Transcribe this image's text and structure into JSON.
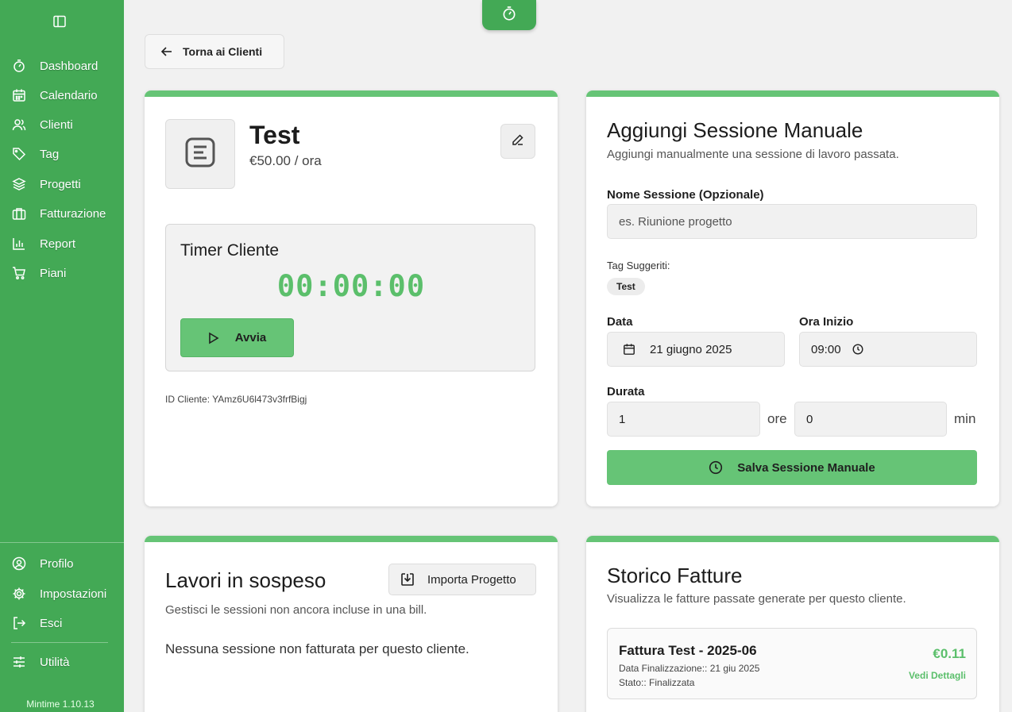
{
  "sidebar": {
    "nav": [
      {
        "label": "Dashboard",
        "icon": "stopwatch-icon"
      },
      {
        "label": "Calendario",
        "icon": "calendar-icon"
      },
      {
        "label": "Clienti",
        "icon": "users-icon"
      },
      {
        "label": "Tag",
        "icon": "tag-icon"
      },
      {
        "label": "Progetti",
        "icon": "layers-icon"
      },
      {
        "label": "Fatturazione",
        "icon": "briefcase-icon"
      },
      {
        "label": "Report",
        "icon": "bar-chart-icon"
      },
      {
        "label": "Piani",
        "icon": "cart-icon"
      }
    ],
    "bottom": [
      {
        "label": "Profilo",
        "icon": "user-circle-icon"
      },
      {
        "label": "Impostazioni",
        "icon": "gear-icon"
      },
      {
        "label": "Esci",
        "icon": "logout-icon"
      }
    ],
    "utility": {
      "label": "Utilità",
      "icon": "sliders-icon"
    },
    "version": "Mintime 1.10.13"
  },
  "back_button": {
    "label": "Torna ai Clienti"
  },
  "client": {
    "name": "Test",
    "rate": "€50.00 / ora",
    "timer_title": "Timer Cliente",
    "timer_value": "00:00:00",
    "start_label": "Avvia",
    "client_id": "ID Cliente: YAmz6U6l473v3frfBigj"
  },
  "manual_session": {
    "title": "Aggiungi Sessione Manuale",
    "subtitle": "Aggiungi manualmente una sessione di lavoro passata.",
    "name_label": "Nome Sessione (Opzionale)",
    "name_placeholder": "es. Riunione progetto",
    "suggested_tags_label": "Tag Suggeriti:",
    "suggested_tags": [
      "Test"
    ],
    "date_label": "Data",
    "date_value": "21 giugno 2025",
    "start_label": "Ora Inizio",
    "start_value": "09:00",
    "duration_label": "Durata",
    "hours_value": "1",
    "hours_unit": "ore",
    "minutes_value": "0",
    "minutes_unit": "min",
    "save_label": "Salva Sessione Manuale"
  },
  "pending": {
    "title": "Lavori in sospeso",
    "subtitle": "Gestisci le sessioni non ancora incluse in una bill.",
    "import_label": "Importa Progetto",
    "empty_message": "Nessuna sessione non fatturata per questo cliente."
  },
  "invoices": {
    "title": "Storico Fatture",
    "subtitle": "Visualizza le fatture passate generate per questo cliente.",
    "items": [
      {
        "title": "Fattura Test - 2025-06",
        "finalized": "Data Finalizzazione:: 21 giu 2025",
        "status": "Stato:: Finalizzata",
        "amount": "€0.11",
        "link": "Vedi Dettagli"
      }
    ]
  },
  "colors": {
    "accent": "#43a955",
    "accent_light": "#66c476",
    "accent_text": "#5bbf6b"
  }
}
